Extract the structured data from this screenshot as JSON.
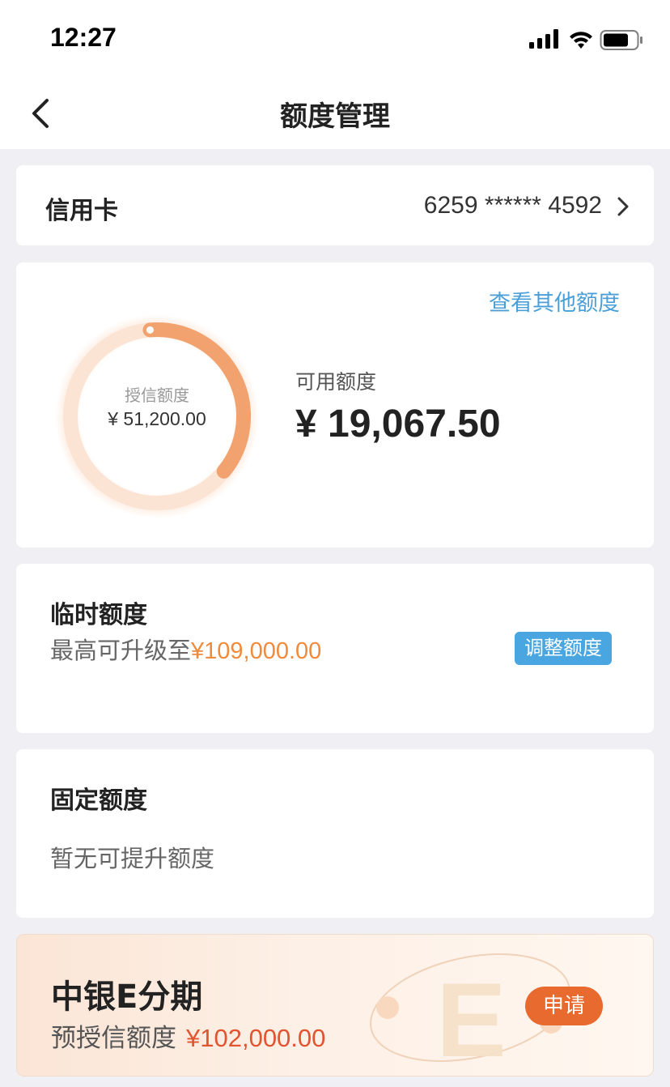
{
  "status_bar": {
    "time": "12:27"
  },
  "nav": {
    "title": "额度管理"
  },
  "card_select": {
    "label": "信用卡",
    "card_number": "6259 ****** 4592"
  },
  "limit_summary": {
    "link_text": "查看其他额度",
    "credit_label": "授信额度",
    "credit_value": "¥ 51,200.00",
    "available_label": "可用额度",
    "available_value": "¥ 19,067.50",
    "available_fraction": 0.372,
    "ring_color": "#f2a26e"
  },
  "temp_limit": {
    "title": "临时额度",
    "sub_prefix": "最高可升级至",
    "sub_amount": "¥109,000.00",
    "button_label": "调整额度"
  },
  "fixed_limit": {
    "title": "固定额度",
    "sub": "暂无可提升额度"
  },
  "installment": {
    "title": "中银E分期",
    "sub_prefix": "预授信额度",
    "sub_amount": "¥102,000.00",
    "button_label": "申请"
  }
}
